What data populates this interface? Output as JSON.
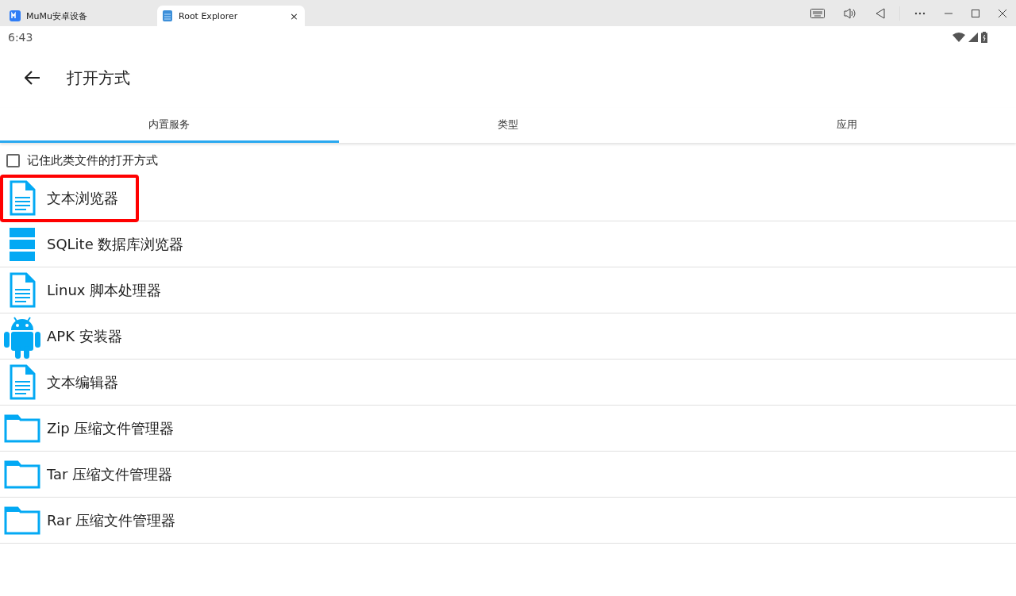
{
  "browser_tabs": [
    {
      "label": "MuMu安卓设备",
      "selected": false
    },
    {
      "label": "Root Explorer",
      "selected": true,
      "close": "×"
    }
  ],
  "status_bar": {
    "time": "6:43"
  },
  "app_bar": {
    "title": "打开方式"
  },
  "tabs": [
    {
      "label": "内置服务",
      "selected": true
    },
    {
      "label": "类型",
      "selected": false
    },
    {
      "label": "应用",
      "selected": false
    }
  ],
  "remember": {
    "label": "记住此类文件的打开方式",
    "checked": false
  },
  "items": [
    {
      "kind": "document",
      "label": "文本浏览器",
      "highlighted": true
    },
    {
      "kind": "database",
      "label": "SQLite 数据库浏览器",
      "highlighted": false
    },
    {
      "kind": "document",
      "label": "Linux 脚本处理器",
      "highlighted": false
    },
    {
      "kind": "android",
      "label": "APK 安装器",
      "highlighted": false
    },
    {
      "kind": "document",
      "label": "文本编辑器",
      "highlighted": false
    },
    {
      "kind": "folder",
      "label": "Zip 压缩文件管理器",
      "highlighted": false
    },
    {
      "kind": "folder",
      "label": "Tar 压缩文件管理器",
      "highlighted": false
    },
    {
      "kind": "folder",
      "label": "Rar 压缩文件管理器",
      "highlighted": false
    }
  ]
}
